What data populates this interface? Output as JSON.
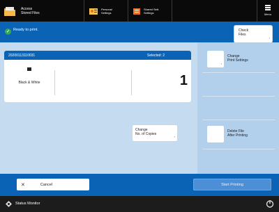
{
  "topbar": {
    "access": {
      "line1": "Access",
      "line2": "Stored Files"
    },
    "personal": {
      "line1": "Personal",
      "line2": "Settings"
    },
    "shared": {
      "line1": "Shared Sett.",
      "line2": "Settings"
    },
    "menu_label": "Menu"
  },
  "status": {
    "message": "Ready to print."
  },
  "check_files": {
    "line1": "Check",
    "line2": "Files"
  },
  "card": {
    "file_id": "20200113110031",
    "selected": "Selected: 2",
    "color_mode": "Black & White",
    "copies": "1"
  },
  "change_copies": {
    "line1": "Change",
    "line2": "No. of Copies"
  },
  "change_print_settings": {
    "line1": "Change",
    "line2": "Print Settings"
  },
  "delete_file": {
    "line1": "Delete File",
    "line2": "After Printing"
  },
  "cancel": {
    "label": "Cancel"
  },
  "start_printing": {
    "label": "Start Printing"
  },
  "footer": {
    "status_monitor": "Status Monitor"
  },
  "colors": {
    "accent": "#0b63b5",
    "ready": "#34a853",
    "top_bar": "#0a0a0a"
  }
}
